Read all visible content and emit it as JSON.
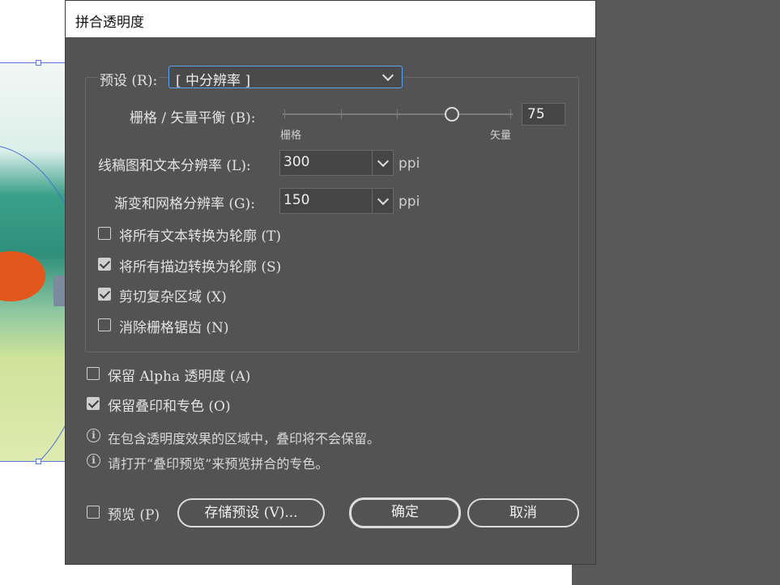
{
  "dialog": {
    "title": "拼合透明度",
    "preset": {
      "label": "预设 (R):",
      "value": "[ 中分辨率 ]"
    },
    "balance": {
      "label": "栅格 / 矢量平衡 (B):",
      "min_label": "栅格",
      "max_label": "矢量",
      "value": "75",
      "level": 75
    },
    "line_art_resolution": {
      "label": "线稿图和文本分辨率 (L):",
      "value": "300",
      "unit": "ppi"
    },
    "gradient_resolution": {
      "label": "渐变和网格分辨率 (G):",
      "value": "150",
      "unit": "ppi"
    },
    "options": [
      {
        "label": "将所有文本转换为轮廓 (T)",
        "checked": false
      },
      {
        "label": "将所有描边转换为轮廓 (S)",
        "checked": true
      },
      {
        "label": "剪切复杂区域 (X)",
        "checked": true
      },
      {
        "label": "消除栅格锯齿 (N)",
        "checked": false
      }
    ],
    "preserve_alpha": {
      "label": "保留 Alpha 透明度 (A)",
      "checked": false
    },
    "preserve_overprint": {
      "label": "保留叠印和专色 (O)",
      "checked": true
    },
    "info": [
      "在包含透明度效果的区域中，叠印将不会保留。",
      "请打开“叠印预览”来预览拼合的专色。"
    ],
    "preview": {
      "label": "预览 (P)",
      "checked": false
    },
    "buttons": {
      "save_preset": "存储预设 (V)...",
      "ok": "确定",
      "cancel": "取消"
    }
  },
  "icons": {
    "info": "info-icon",
    "dropdown": "chevron-down-icon"
  },
  "colors": {
    "dialog_bg": "#535353",
    "focus": "#5ea2f5",
    "workspace": "#595959"
  }
}
